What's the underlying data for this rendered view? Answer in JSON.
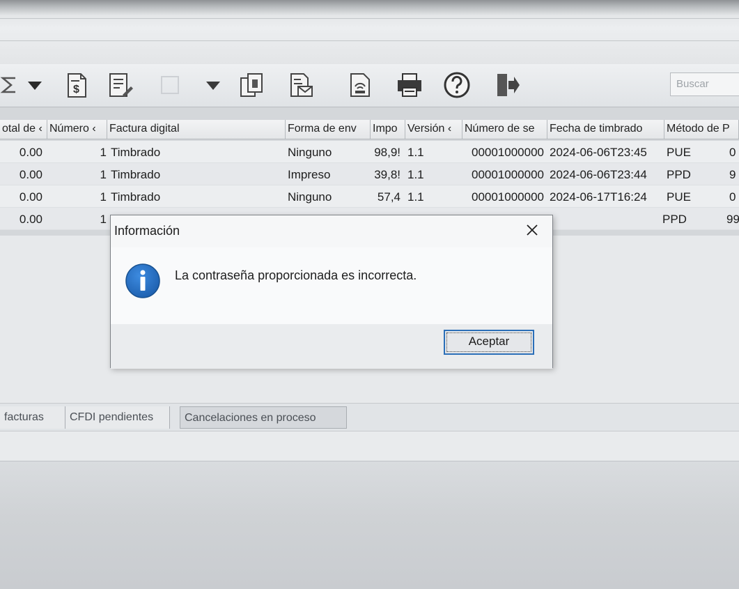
{
  "toolbar": {
    "icons": [
      "sigma-icon",
      "dropdown-arrow-icon",
      "invoice-dollar-icon",
      "edit-document-icon",
      "disabled-icon",
      "dropdown-arrow-icon",
      "copy-document-icon",
      "email-document-icon",
      "scan-document-icon",
      "print-icon",
      "help-icon",
      "exit-icon"
    ],
    "search_placeholder": "Buscar"
  },
  "grid": {
    "columns": [
      "otal de ‹",
      "Número ‹",
      "Factura digital",
      "Forma de env",
      "Impo",
      "Versión ‹",
      "Número de se",
      "Fecha de timbrado",
      "Método de P"
    ],
    "rows": [
      {
        "total": "0.00",
        "numero": "1",
        "factura": "Timbrado",
        "forma": "Ninguno",
        "importe": "98,9!",
        "version": "1.1",
        "num_serie": "00001000000",
        "fecha": "2024-06-06T23:45",
        "metodo": "PUE",
        "extra": "0"
      },
      {
        "total": "0.00",
        "numero": "1",
        "factura": "Timbrado",
        "forma": "Impreso",
        "importe": "39,8!",
        "version": "1.1",
        "num_serie": "00001000000",
        "fecha": "2024-06-06T23:44",
        "metodo": "PPD",
        "extra": "9"
      },
      {
        "total": "0.00",
        "numero": "1",
        "factura": "Timbrado",
        "forma": "Ninguno",
        "importe": "57,4",
        "version": "1.1",
        "num_serie": "00001000000",
        "fecha": "2024-06-17T16:24",
        "metodo": "PUE",
        "extra": "0"
      },
      {
        "total": "0.00",
        "numero": "1",
        "factura": "",
        "forma": "",
        "importe": "",
        "version": "",
        "num_serie": "",
        "fecha": "",
        "metodo": "PPD",
        "extra": "99"
      }
    ]
  },
  "tabs": [
    "facturas",
    "CFDI pendientes",
    "Cancelaciones en proceso"
  ],
  "dialog": {
    "title": "Información",
    "message": "La contraseña proporcionada es incorrecta.",
    "ok_label": "Aceptar"
  },
  "colors": {
    "accent": "#2b6fb8",
    "info_icon": "#1d5fae"
  }
}
